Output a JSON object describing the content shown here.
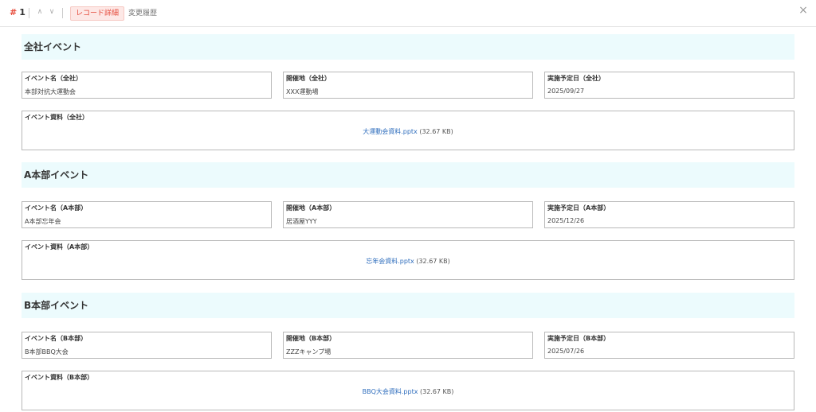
{
  "header": {
    "hash": "#",
    "record_number": "1",
    "prev_icon": "∧",
    "next_icon": "∨",
    "tabs": [
      {
        "label": "レコード詳細",
        "active": true
      },
      {
        "label": "変更履歴",
        "active": false
      }
    ],
    "close_icon": "×"
  },
  "sections": [
    {
      "title": "全社イベント",
      "fields": [
        {
          "label": "イベント名（全社）",
          "value": "本部対抗大運動会"
        },
        {
          "label": "開催地（全社）",
          "value": "XXX運動場"
        },
        {
          "label": "実施予定日（全社）",
          "value": "2025/09/27"
        }
      ],
      "attachment": {
        "label": "イベント資料（全社）",
        "file_name": "大運動会資料.pptx",
        "file_size": "(32.67 KB)"
      }
    },
    {
      "title": "A本部イベント",
      "fields": [
        {
          "label": "イベント名（A本部）",
          "value": "A本部忘年会"
        },
        {
          "label": "開催地（A本部）",
          "value": "居酒屋YYY"
        },
        {
          "label": "実施予定日（A本部）",
          "value": "2025/12/26"
        }
      ],
      "attachment": {
        "label": "イベント資料（A本部）",
        "file_name": "忘年会資料.pptx",
        "file_size": "(32.67 KB)"
      }
    },
    {
      "title": "B本部イベント",
      "fields": [
        {
          "label": "イベント名（B本部）",
          "value": "B本部BBQ大会"
        },
        {
          "label": "開催地（B本部）",
          "value": "ZZZキャンプ場"
        },
        {
          "label": "実施予定日（B本部）",
          "value": "2025/07/26"
        }
      ],
      "attachment": {
        "label": "イベント資料（B本部）",
        "file_name": "BBQ大会資料.pptx",
        "file_size": "(32.67 KB)"
      }
    }
  ]
}
